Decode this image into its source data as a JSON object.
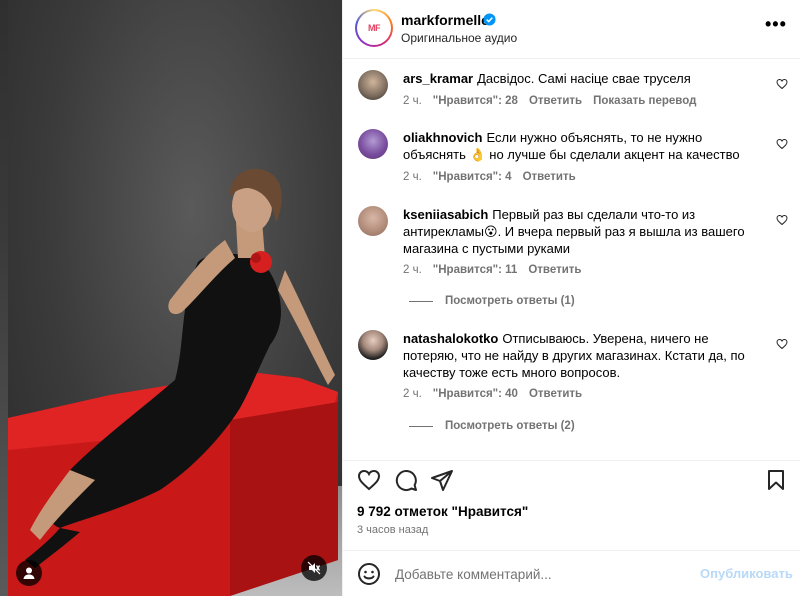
{
  "post": {
    "username": "markformelle",
    "subtitle": "Оригинальное аудио",
    "logo_text_m": "MF",
    "verified_color": "#0095f6",
    "more_label": "•••",
    "likes_text": "9 792 отметок \"Нравится\"",
    "time_text": "3 часов назад"
  },
  "comments": [
    {
      "username": "ars_kramar",
      "text": "Дасвідос. Самі насіце сваe труселя",
      "time": "2 ч.",
      "likes": "\"Нравится\": 28",
      "reply": "Ответить",
      "translate": "Показать перевод"
    },
    {
      "username": "oliakhnovich",
      "text": "Если нужно объяснять, то не нужно объяснять 👌 но лучше бы сделали акцент на качество",
      "time": "2 ч.",
      "likes": "\"Нравится\": 4",
      "reply": "Ответить"
    },
    {
      "username": "kseniiasabich",
      "text": "Первый раз вы сделали что-то из антирекламы😮. И вчера первый раз я вышла из вашего магазина с пустыми руками",
      "time": "2 ч.",
      "likes": "\"Нравится\": 11",
      "reply": "Ответить",
      "view_replies": "Посмотреть ответы (1)"
    },
    {
      "username": "natashalokotko",
      "text": "Отписываюсь. Уверена, ничего не потеряю, что не найду в других магазинах. Кстати да, по качеству тоже есть много вопросов.",
      "time": "2 ч.",
      "likes": "\"Нравится\": 40",
      "reply": "Ответить",
      "view_replies": "Посмотреть ответы (2)"
    }
  ],
  "composer": {
    "placeholder": "Добавьте комментарий...",
    "publish_label": "Опубликовать"
  },
  "colors": {
    "accent_red": "#d61f1f",
    "muted_text": "#737373",
    "publish_disabled": "#b8d9f7"
  },
  "icons": {
    "heart": "heart-icon",
    "comment": "comment-icon",
    "share": "paper-plane-icon",
    "save": "bookmark-icon",
    "emoji": "smiley-icon",
    "mute": "speaker-muted-icon",
    "user": "user-icon"
  }
}
